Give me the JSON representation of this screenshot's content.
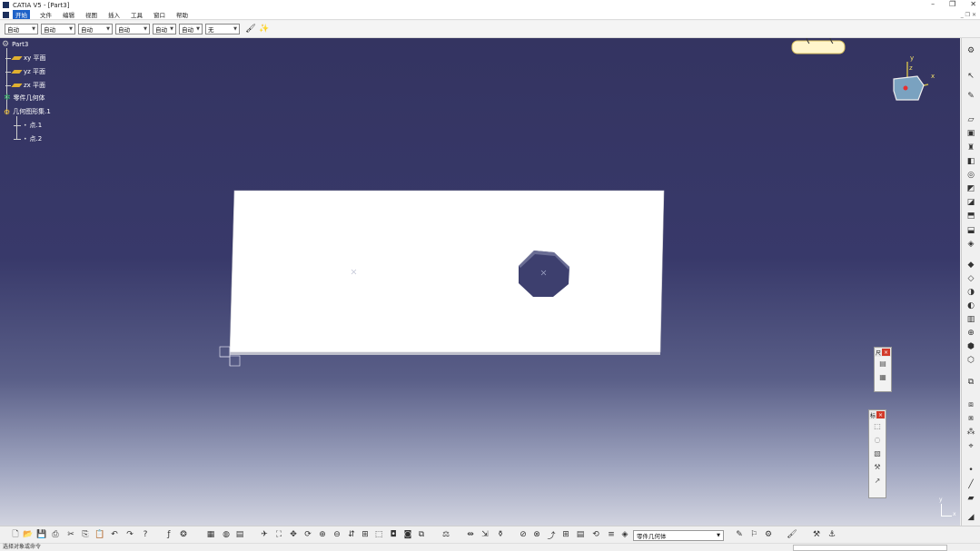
{
  "window": {
    "title": "CATIA V5 - [Part3]",
    "minimize": "–",
    "restore": "❐",
    "close": "✕"
  },
  "menu": {
    "items": [
      "开始",
      "文件",
      "编辑",
      "视图",
      "插入",
      "工具",
      "窗口",
      "帮助"
    ],
    "active": "开始",
    "mdi_controls": "_ ❐ ✕"
  },
  "properties_toolbar": {
    "fields": [
      "自动",
      "自动",
      "自动",
      "自动",
      "自动",
      "自动",
      "无"
    ]
  },
  "tree": {
    "root": "Part3",
    "items": [
      "xy 平面",
      "yz 平面",
      "zx 平面",
      "零件几何体",
      "几何图形集.1",
      "点.1",
      "点.2"
    ]
  },
  "compass": {
    "x": "x",
    "y": "y",
    "z": "z"
  },
  "axis_indicator": {
    "y": "y",
    "x": "x"
  },
  "bottom_toolbar": {
    "body_selector": "零件几何体"
  },
  "status": {
    "text": "选择对象或命令"
  },
  "palettes": {
    "p1_label": "尺",
    "p2_label": "标"
  },
  "colors": {
    "viewport_top": "#343461",
    "viewport_bottom": "#d2d4e0",
    "part_face": "#ffffff",
    "hole": "#3d3f6e",
    "menu_active": "#1e62c8"
  }
}
